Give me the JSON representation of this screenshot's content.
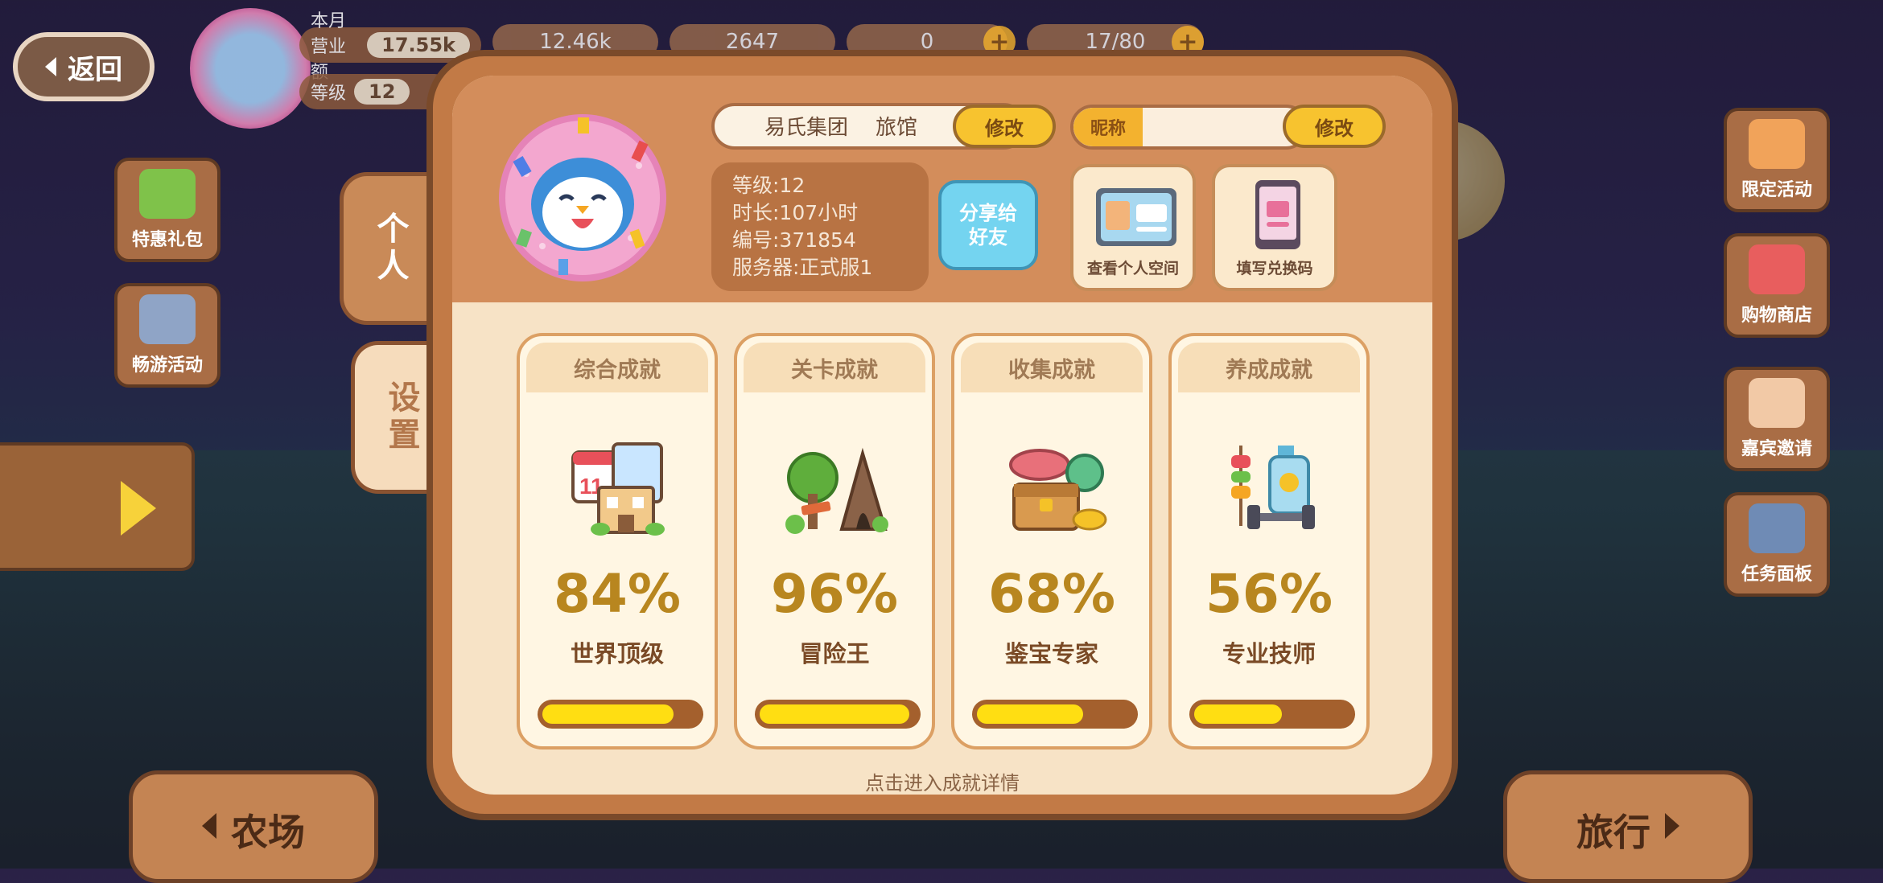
{
  "top_bar": {
    "back_label": "返回",
    "monthly_revenue_label": "本月营业额",
    "monthly_revenue_value": "17.55k",
    "level_label": "等级",
    "level_value": "12",
    "res1": "12.46k",
    "res2": "2647",
    "res3": "0",
    "res4": "17/80"
  },
  "left_side": {
    "gift_pack": "特惠礼包",
    "tour_event": "畅游活动"
  },
  "right_side": {
    "limited_event": "限定活动",
    "shop": "购物商店",
    "invite": "嘉宾邀请",
    "task_board": "任务面板"
  },
  "bottom_nav": {
    "farm": "农场",
    "travel": "旅行"
  },
  "tabs": {
    "personal": "个人",
    "settings": "设置"
  },
  "profile": {
    "group_name": "易氏集团",
    "shop_type": "旅馆",
    "modify_label": "修改",
    "nickname_label": "昵称",
    "nickname_value": "",
    "level_line": "等级:12",
    "duration_line": "时长:107小时",
    "id_line": "编号:371854",
    "server_line": "服务器:正式服1",
    "share_label": "分享给好友",
    "view_space_label": "查看个人空间",
    "redeem_label": "填写兑换码"
  },
  "achievements": [
    {
      "category": "综合成就",
      "percent_text": "84%",
      "percent": 84,
      "title": "世界顶级"
    },
    {
      "category": "关卡成就",
      "percent_text": "96%",
      "percent": 96,
      "title": "冒险王"
    },
    {
      "category": "收集成就",
      "percent_text": "68%",
      "percent": 68,
      "title": "鉴宝专家"
    },
    {
      "category": "养成成就",
      "percent_text": "56%",
      "percent": 56,
      "title": "专业技师"
    }
  ],
  "detail_link": "点击进入成就详情",
  "colors": {
    "panel": "#c27a46",
    "panel_inner": "#f7e3c6",
    "accent_yellow": "#f7c32f",
    "progress_fill": "#ffde12",
    "share_blue": "#74d4f0"
  }
}
